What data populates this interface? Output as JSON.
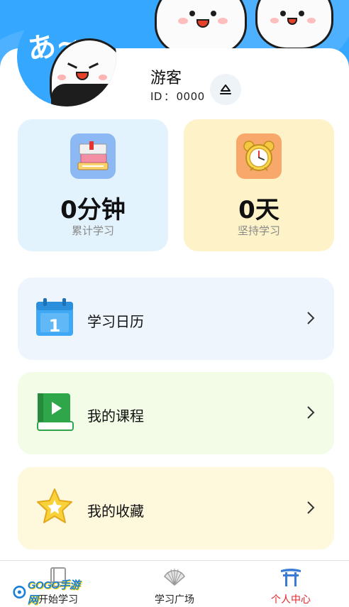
{
  "header": {
    "avatar_kana": "あ~"
  },
  "profile": {
    "name": "游客",
    "id_label": "ID",
    "id_separator": "：",
    "id_value": "0000",
    "edit_icon": "edit-icon"
  },
  "stats": [
    {
      "value": "0分钟",
      "label": "累计学习",
      "icon": "books-icon",
      "color": "#e3f3fe"
    },
    {
      "value": "0天",
      "label": "坚持学习",
      "icon": "alarm-clock-icon",
      "color": "#fef3c8"
    }
  ],
  "menu": [
    {
      "label": "学习日历",
      "icon": "calendar-icon",
      "icon_text": "1",
      "arrow": ">",
      "color": "#eef5fd"
    },
    {
      "label": "我的课程",
      "icon": "course-book-icon",
      "arrow": ">",
      "color": "#f2fce6"
    },
    {
      "label": "我的收藏",
      "icon": "star-icon",
      "arrow": ">",
      "color": "#fef8dc"
    }
  ],
  "bottom_nav": [
    {
      "label": "开始学习",
      "icon": "book-icon",
      "active": false
    },
    {
      "label": "学习广场",
      "icon": "fan-icon",
      "active": false
    },
    {
      "label": "个人中心",
      "icon": "torii-gate-icon",
      "active": true
    }
  ],
  "watermark": {
    "text": "GOGO手游网"
  },
  "colors": {
    "banner": "#36a7ff",
    "active_tab": "#e3242b",
    "text_primary": "#111111",
    "text_secondary": "#888888"
  }
}
